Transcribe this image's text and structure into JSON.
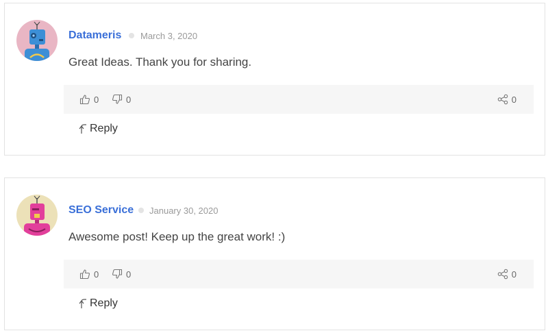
{
  "comments": [
    {
      "author": "Datameris",
      "date": "March 3, 2020",
      "text": "Great Ideas. Thank you for sharing.",
      "likes": "0",
      "dislikes": "0",
      "shares": "0",
      "reply_label": "Reply",
      "avatar": {
        "bg": "#e9b6c4",
        "robot": "#3d8fd6",
        "accent": "#f2c94c"
      }
    },
    {
      "author": "SEO Service",
      "date": "January 30, 2020",
      "text": "Awesome post! Keep up the great work! :)",
      "likes": "0",
      "dislikes": "0",
      "shares": "0",
      "reply_label": "Reply",
      "avatar": {
        "bg": "#ece1b8",
        "robot": "#e23f9b",
        "accent": "#f2c94c"
      }
    }
  ],
  "colors": {
    "author_link": "#3a6fd8",
    "action_bar_bg": "#f6f6f6",
    "border": "#e2e2e2"
  }
}
